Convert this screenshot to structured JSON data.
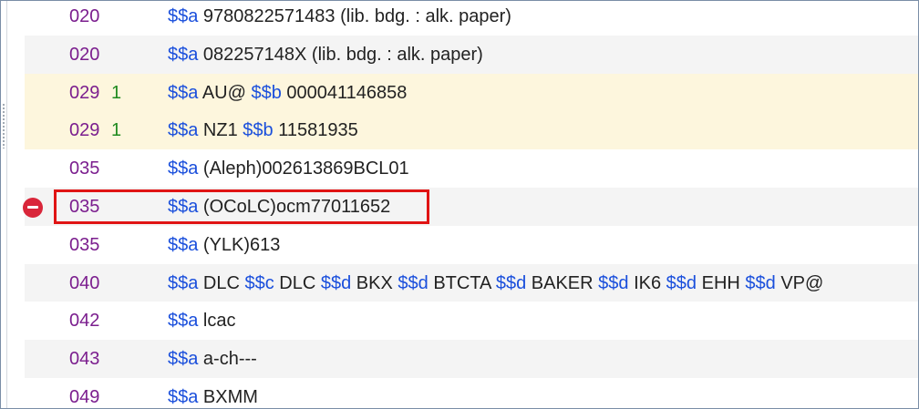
{
  "rows": [
    {
      "tag": "020",
      "ind": "",
      "style": "",
      "parts": [
        [
          "$$a",
          " 9780822571483 (lib. bdg. : alk. paper)"
        ]
      ]
    },
    {
      "tag": "020",
      "ind": "",
      "style": "alt",
      "parts": [
        [
          "$$a",
          " 082257148X (lib. bdg. : alk. paper)"
        ]
      ]
    },
    {
      "tag": "029",
      "ind": "1",
      "style": "local",
      "parts": [
        [
          "$$a",
          " AU@ "
        ],
        [
          "$$b",
          " 000041146858"
        ]
      ]
    },
    {
      "tag": "029",
      "ind": "1",
      "style": "local",
      "parts": [
        [
          "$$a",
          " NZ1 "
        ],
        [
          "$$b",
          " 11581935"
        ]
      ]
    },
    {
      "tag": "035",
      "ind": "",
      "style": "",
      "parts": [
        [
          "$$a",
          " (Aleph)002613869BCL01"
        ]
      ]
    },
    {
      "tag": "035",
      "ind": "",
      "style": "alt",
      "marked": true,
      "parts": [
        [
          "$$a",
          " (OCoLC)ocm77011652"
        ]
      ]
    },
    {
      "tag": "035",
      "ind": "",
      "style": "",
      "parts": [
        [
          "$$a",
          " (YLK)613"
        ]
      ]
    },
    {
      "tag": "040",
      "ind": "",
      "style": "alt",
      "parts": [
        [
          "$$a",
          " DLC "
        ],
        [
          "$$c",
          " DLC "
        ],
        [
          "$$d",
          " BKX "
        ],
        [
          "$$d",
          " BTCTA "
        ],
        [
          "$$d",
          " BAKER "
        ],
        [
          "$$d",
          " IK6 "
        ],
        [
          "$$d",
          " EHH "
        ],
        [
          "$$d",
          " VP@"
        ]
      ]
    },
    {
      "tag": "042",
      "ind": "",
      "style": "",
      "parts": [
        [
          "$$a",
          " lcac"
        ]
      ]
    },
    {
      "tag": "043",
      "ind": "",
      "style": "alt",
      "parts": [
        [
          "$$a",
          " a-ch---"
        ]
      ]
    },
    {
      "tag": "049",
      "ind": "",
      "style": "",
      "parts": [
        [
          "$$a",
          " BXMM"
        ]
      ]
    }
  ],
  "colors": {
    "tag": "#7b1e8e",
    "indicator": "#1f8a1f",
    "subfield_code": "#1a4fdc",
    "highlight": "#e01414",
    "delete_icon": "#d9263a",
    "local_row_bg": "#fdf6dd",
    "alt_row_bg": "#f4f4f4"
  },
  "icons": {
    "delete": "minus-circle-icon"
  }
}
